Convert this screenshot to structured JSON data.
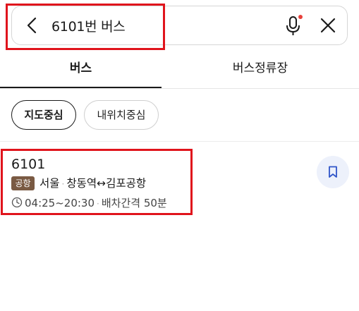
{
  "search": {
    "query": "6101번 버스"
  },
  "tabs": [
    {
      "label": "버스",
      "active": true
    },
    {
      "label": "버스정류장",
      "active": false
    }
  ],
  "filters": [
    {
      "label": "지도중심",
      "selected": true
    },
    {
      "label": "내위치중심",
      "selected": false
    }
  ],
  "results": [
    {
      "route_number": "6101",
      "badge": "공항",
      "region": "서울",
      "origin": "창동역",
      "arrow": "↔",
      "destination": "김포공항",
      "hours": "04:25~20:30",
      "interval": "배차간격 50분"
    }
  ],
  "colors": {
    "highlight": "#e0141c",
    "badge_bg": "#7a5a43",
    "mic_dot": "#e8413b",
    "bookmark_bg": "#edf1fb",
    "bookmark_icon": "#2f55c9"
  },
  "icons": [
    "back-arrow-icon",
    "microphone-icon",
    "close-icon",
    "clock-icon",
    "bookmark-icon"
  ]
}
